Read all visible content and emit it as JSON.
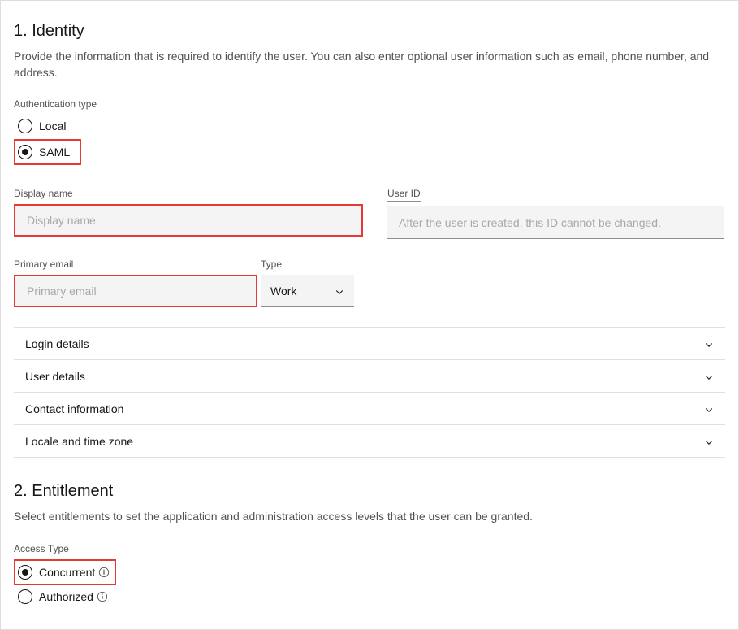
{
  "identity": {
    "title": "1. Identity",
    "description": "Provide the information that is required to identify the user. You can also enter optional user information such as email, phone number, and address.",
    "auth_type": {
      "label": "Authentication type",
      "options": {
        "local": "Local",
        "saml": "SAML"
      },
      "selected": "saml"
    },
    "display_name": {
      "label": "Display name",
      "placeholder": "Display name",
      "value": ""
    },
    "user_id": {
      "label": "User ID",
      "placeholder": "After the user is created, this ID cannot be changed.",
      "value": ""
    },
    "primary_email": {
      "label": "Primary email",
      "placeholder": "Primary email",
      "value": ""
    },
    "email_type": {
      "label": "Type",
      "selected": "Work"
    },
    "accordion": {
      "login_details": "Login details",
      "user_details": "User details",
      "contact_info": "Contact information",
      "locale": "Locale and time zone"
    }
  },
  "entitlement": {
    "title": "2. Entitlement",
    "description": "Select entitlements to set the application and administration access levels that the user can be granted.",
    "access_type": {
      "label": "Access Type",
      "options": {
        "concurrent": "Concurrent",
        "authorized": "Authorized"
      },
      "selected": "concurrent"
    }
  }
}
